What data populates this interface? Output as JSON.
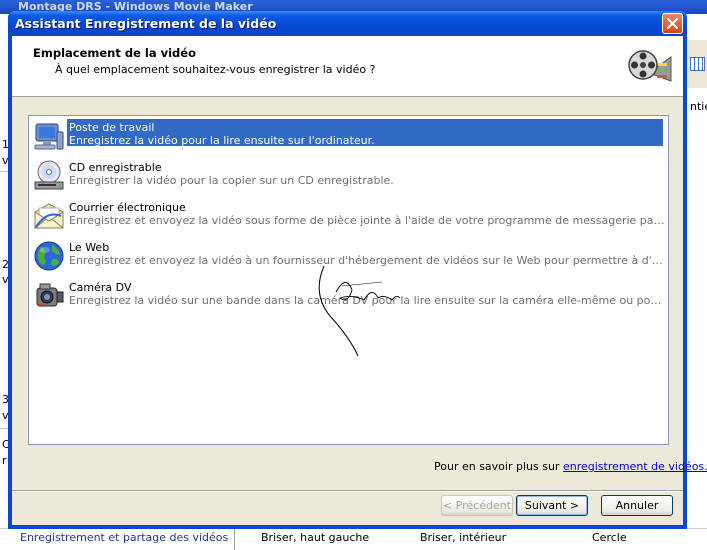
{
  "background_app": {
    "title": "Montage DRS - Windows Movie Maker",
    "right_text": "ntie",
    "left_labels": [
      "1",
      "v",
      "2",
      "v",
      "3",
      "v",
      "C",
      "r"
    ],
    "bottom": {
      "link": "Enregistrement et partage des vidéos",
      "items": [
        "Briser, haut gauche",
        "Briser, intérieur",
        "Cercle"
      ]
    }
  },
  "dialog": {
    "title": "Assistant Enregistrement de la vidéo",
    "header": {
      "title": "Emplacement de la vidéo",
      "subtitle": "À quel emplacement souhaitez-vous enregistrer la vidéo ?",
      "icon": "film-reel-icon"
    },
    "options": [
      {
        "title": "Poste de travail",
        "desc": "Enregistrez la vidéo pour la lire ensuite sur l'ordinateur.",
        "icon": "computer-icon",
        "selected": true
      },
      {
        "title": "CD enregistrable",
        "desc": "Enregistrer la vidéo pour la copier sur un CD enregistrable.",
        "icon": "cd-drive-icon",
        "selected": false
      },
      {
        "title": "Courrier électronique",
        "desc": "Enregistrez et envoyez la vidéo sous forme de pièce jointe à l'aide de votre programme de messagerie par défaut.",
        "icon": "email-icon",
        "selected": false
      },
      {
        "title": "Le Web",
        "desc": "Enregistrez et envoyez la vidéo à un fournisseur d'hébergement de vidéos sur le Web pour permettre à d'autres personnes de la regarder.",
        "icon": "globe-icon",
        "selected": false
      },
      {
        "title": "Caméra DV",
        "desc": "Enregistrez la vidéo sur une bande dans la caméra DV pour la lire ensuite sur la caméra elle-même ou pour la regarder sur un téléviseur.",
        "icon": "dv-camera-icon",
        "selected": false
      }
    ],
    "learn_more": {
      "prefix": "Pour en savoir plus sur ",
      "link": "enregistrement de vidéos."
    },
    "buttons": {
      "previous": "< Précédent",
      "next": "Suivant >",
      "cancel": "Annuler"
    },
    "colors": {
      "title_bar": "#0a46d8",
      "selection": "#316ac5",
      "close_button": "#d4451f"
    }
  }
}
